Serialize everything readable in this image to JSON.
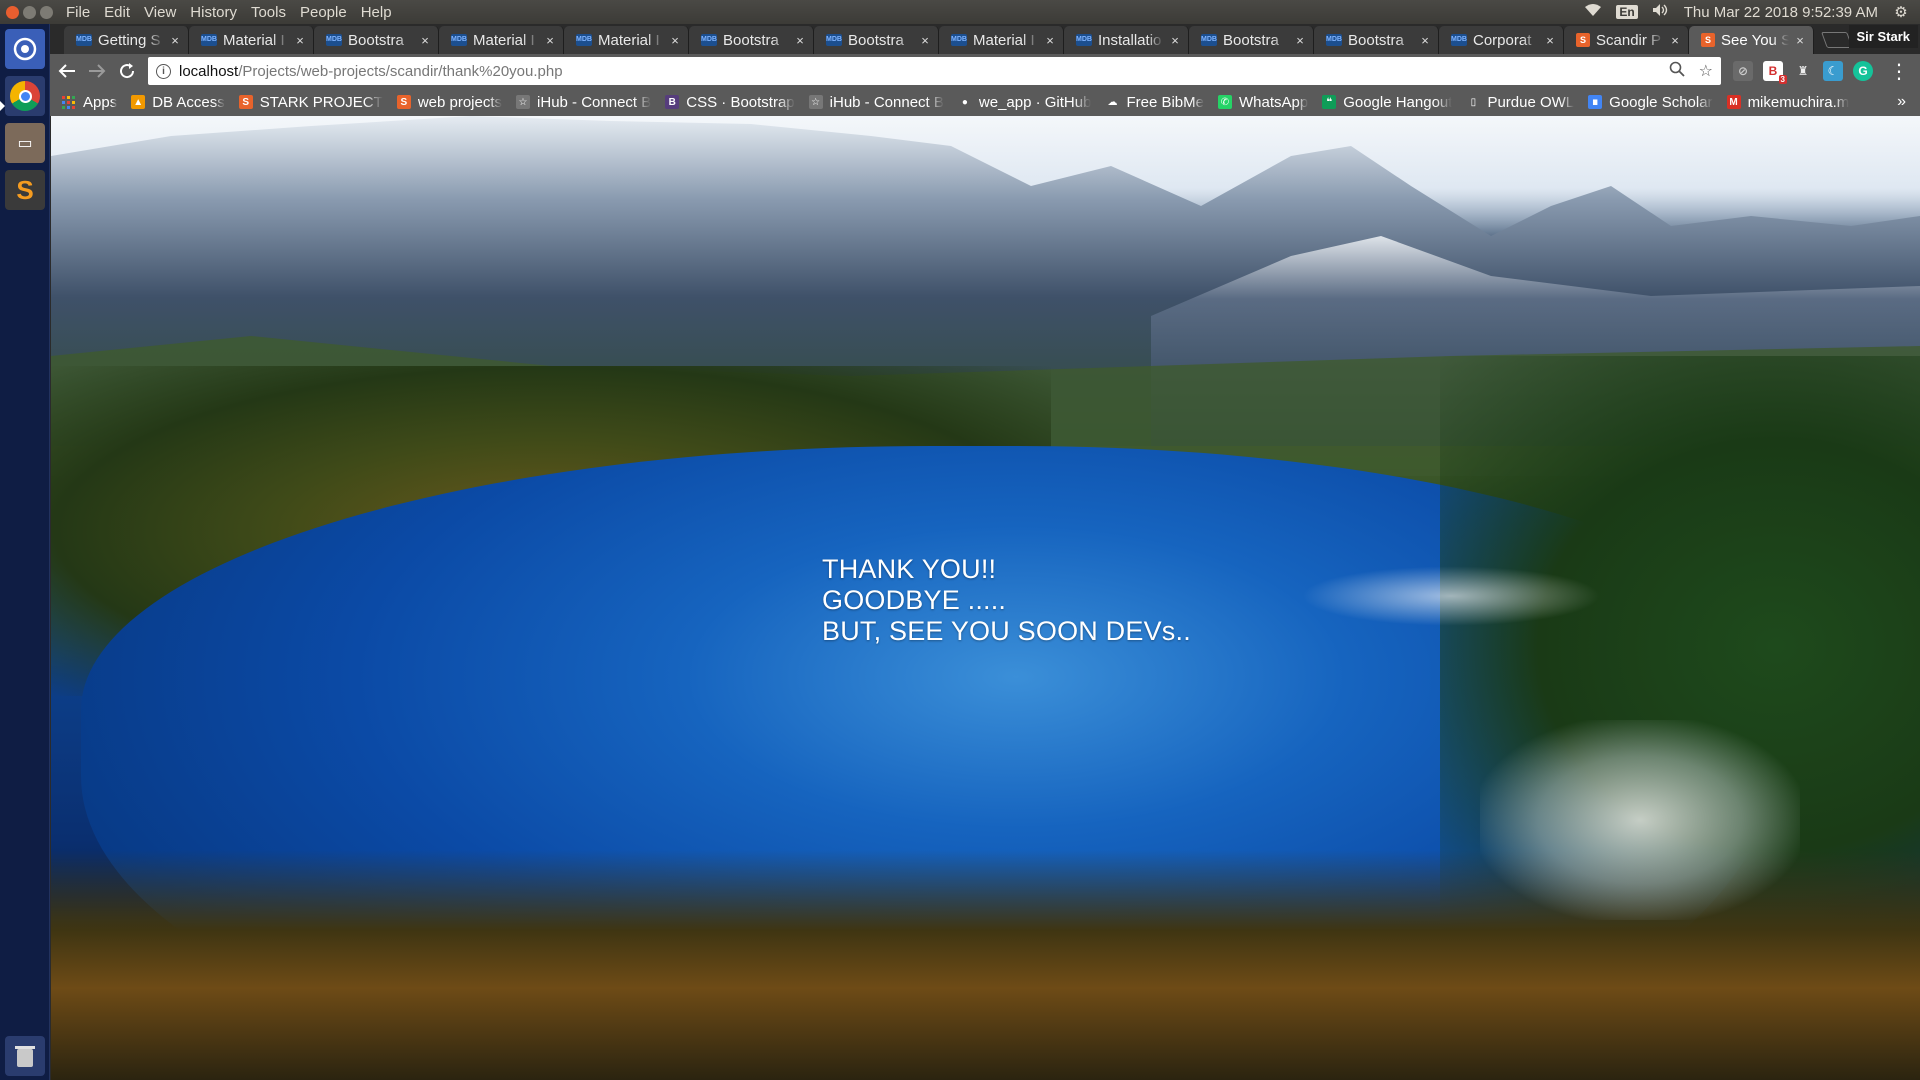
{
  "top_panel": {
    "menu": [
      "File",
      "Edit",
      "View",
      "History",
      "Tools",
      "People",
      "Help"
    ],
    "language": "En",
    "datetime": "Thu Mar 22 2018 9:52:39 AM",
    "icons": [
      "wifi-icon",
      "volume-icon",
      "gear-icon"
    ]
  },
  "launcher": {
    "items": [
      "home-icon",
      "chrome-icon",
      "files-icon",
      "sublime-text-icon",
      "trash-icon"
    ],
    "files_glyph": "▭",
    "sublime_glyph": "S"
  },
  "tabs": [
    {
      "title": "Getting S",
      "favicon": "MDB",
      "active": false
    },
    {
      "title": "Material I",
      "favicon": "MDB",
      "active": false
    },
    {
      "title": "Bootstra",
      "favicon": "MDB",
      "active": false
    },
    {
      "title": "Material I",
      "favicon": "MDB",
      "active": false
    },
    {
      "title": "Material I",
      "favicon": "MDB",
      "active": false
    },
    {
      "title": "Bootstra",
      "favicon": "MDB",
      "active": false
    },
    {
      "title": "Bootstra",
      "favicon": "MDB",
      "active": false
    },
    {
      "title": "Material I",
      "favicon": "MDB",
      "active": false
    },
    {
      "title": "Installatio",
      "favicon": "MDB",
      "active": false
    },
    {
      "title": "Bootstra",
      "favicon": "MDB",
      "active": false
    },
    {
      "title": "Bootstra",
      "favicon": "MDB",
      "active": false
    },
    {
      "title": "Corporat",
      "favicon": "MDB",
      "active": false
    },
    {
      "title": "Scandir P",
      "favicon": "S",
      "active": false
    },
    {
      "title": "See You S",
      "favicon": "S",
      "active": true
    }
  ],
  "profile_name": "Sir Stark",
  "toolbar": {
    "url_host": "localhost",
    "url_path": "/Projects/web-projects/scandir/thank%20you.php"
  },
  "bookmarks": [
    {
      "label": "Apps",
      "icon": "apps-grid-icon",
      "color": "#e94235"
    },
    {
      "label": "DB Access",
      "icon": "database-icon",
      "color": "#f29900"
    },
    {
      "label": "STARK PROJECT",
      "icon": "scandir-icon",
      "color": "#e8632b"
    },
    {
      "label": "web projects",
      "icon": "scandir-icon",
      "color": "#e8632b"
    },
    {
      "label": "iHub - Connect B",
      "icon": "star-icon",
      "color": "#777777"
    },
    {
      "label": "CSS · Bootstrap",
      "icon": "bootstrap-icon",
      "color": "#563d7c"
    },
    {
      "label": "iHub - Connect B",
      "icon": "star-icon",
      "color": "#777777"
    },
    {
      "label": "we_app · GitHub",
      "icon": "github-icon",
      "color": "#5a5a5a"
    },
    {
      "label": "Free BibMe",
      "icon": "bibme-icon",
      "color": "#5a5a5a"
    },
    {
      "label": "WhatsApp",
      "icon": "whatsapp-icon",
      "color": "#25d366"
    },
    {
      "label": "Google Hangout",
      "icon": "hangouts-icon",
      "color": "#0f9d58"
    },
    {
      "label": "Purdue OWL",
      "icon": "document-icon",
      "color": "#5a5a5a"
    },
    {
      "label": "Google Scholar",
      "icon": "scholar-icon",
      "color": "#4285f4"
    },
    {
      "label": "mikemuchira.m",
      "icon": "gmail-icon",
      "color": "#d93025"
    }
  ],
  "bookmarks_more": "»",
  "page": {
    "line1": "THANK YOU!!",
    "line2": "GOODBYE .....",
    "line3": "BUT, SEE YOU SOON DEVs.."
  }
}
